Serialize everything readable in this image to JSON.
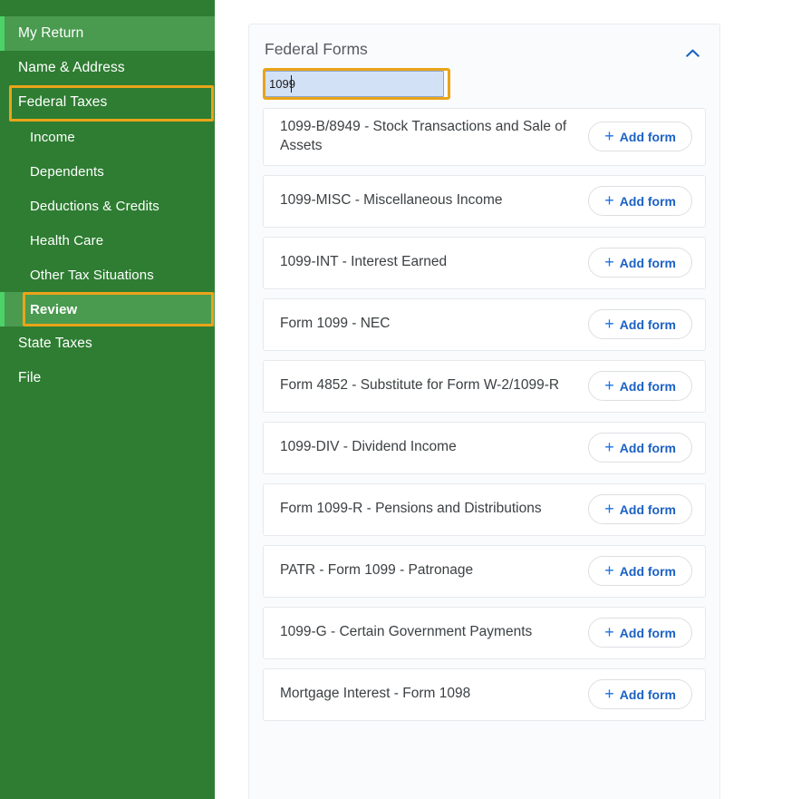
{
  "colors": {
    "sidebar_bg": "#2e7d32",
    "sidebar_active_bg": "#4a9a50",
    "sidebar_accent": "#4dd268",
    "highlight_orange": "#eaa419",
    "link_blue": "#1b61c4",
    "plus_blue": "#1a73e8",
    "panel_bg": "#fafbfc"
  },
  "sidebar": {
    "items": [
      {
        "label": "My Return",
        "level": "top",
        "active": true,
        "bold": false,
        "highlighted": false
      },
      {
        "label": "Name & Address",
        "level": "top",
        "active": false,
        "bold": false,
        "highlighted": false
      },
      {
        "label": "Federal Taxes",
        "level": "top",
        "active": false,
        "bold": false,
        "highlighted": true
      },
      {
        "label": "Income",
        "level": "sub",
        "active": false,
        "bold": false,
        "highlighted": false
      },
      {
        "label": "Dependents",
        "level": "sub",
        "active": false,
        "bold": false,
        "highlighted": false
      },
      {
        "label": "Deductions & Credits",
        "level": "sub",
        "active": false,
        "bold": false,
        "highlighted": false
      },
      {
        "label": "Health Care",
        "level": "sub",
        "active": false,
        "bold": false,
        "highlighted": false
      },
      {
        "label": "Other Tax Situations",
        "level": "sub",
        "active": false,
        "bold": false,
        "highlighted": false
      },
      {
        "label": "Review",
        "level": "sub",
        "active": true,
        "bold": true,
        "highlighted": true
      },
      {
        "label": "State Taxes",
        "level": "top",
        "active": false,
        "bold": false,
        "highlighted": false
      },
      {
        "label": "File",
        "level": "top",
        "active": false,
        "bold": false,
        "highlighted": false
      }
    ]
  },
  "panel": {
    "title": "Federal Forms",
    "collapse_icon": "chevron-up-icon",
    "search": {
      "value": "1099",
      "placeholder": "",
      "focused": true
    },
    "add_button_label": "Add form",
    "add_button_icon": "plus-icon",
    "forms": [
      {
        "label": "1099-B/8949 - Stock Transactions and Sale of Assets"
      },
      {
        "label": "1099-MISC - Miscellaneous Income"
      },
      {
        "label": "1099-INT - Interest Earned"
      },
      {
        "label": "Form 1099 - NEC"
      },
      {
        "label": "Form 4852 - Substitute for Form W-2/1099-R"
      },
      {
        "label": "1099-DIV - Dividend Income"
      },
      {
        "label": "Form 1099-R - Pensions and Distributions"
      },
      {
        "label": "PATR - Form 1099 - Patronage"
      },
      {
        "label": "1099-G - Certain Government Payments"
      },
      {
        "label": "Mortgage Interest - Form 1098"
      }
    ]
  }
}
